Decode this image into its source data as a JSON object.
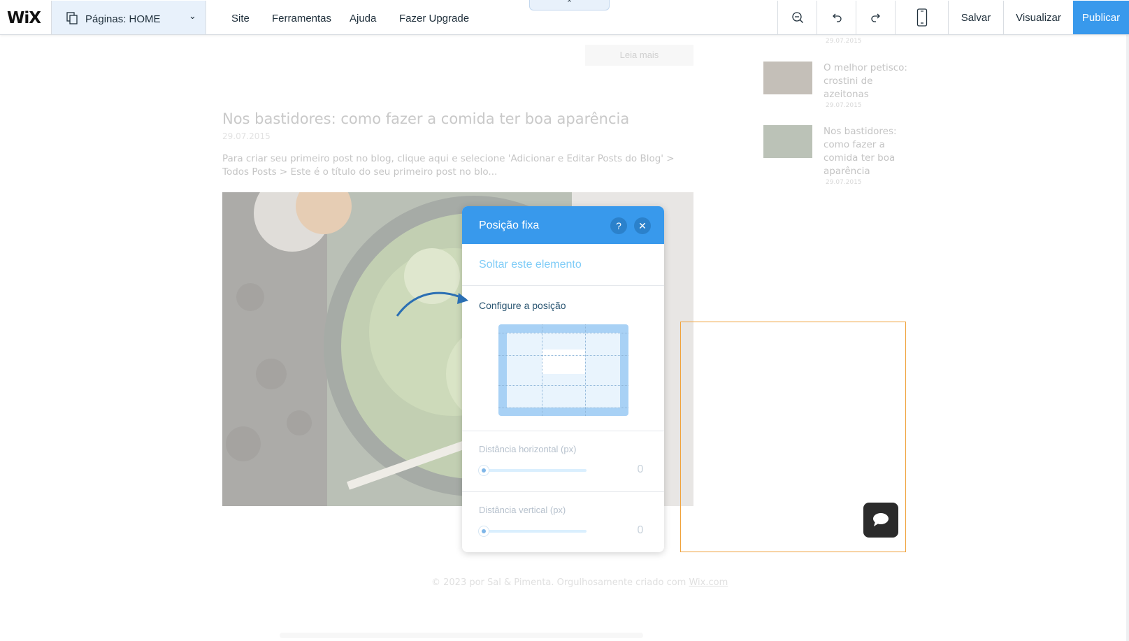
{
  "topbar": {
    "logo": "WiX",
    "pages_label": "Páginas: HOME",
    "pages_caret": "⌄",
    "menu": [
      "Site",
      "Ferramentas",
      "Ajuda",
      "Fazer Upgrade"
    ],
    "collapse_glyph": "⌃",
    "save": "Salvar",
    "preview": "Visualizar",
    "publish": "Publicar",
    "icons": [
      "zoom-out-icon",
      "undo-icon",
      "redo-icon",
      "mobile-view-icon"
    ]
  },
  "page": {
    "read_more": "Leia mais",
    "post_title": "Nos bastidores: como fazer a comida ter boa aparência",
    "post_date": "29.07.2015",
    "post_excerpt": "Para criar seu primeiro post no blog, clique aqui e selecione 'Adicionar e Editar Posts do Blog' > Todos Posts > Este é o título do seu primeiro post no blo...",
    "sidebar_posts": [
      {
        "date": "29.07.2015"
      },
      {
        "title": "O melhor petisco: crostini de azeitonas",
        "date": "29.07.2015"
      },
      {
        "title": "Nos bastidores: como fazer a comida ter boa aparência",
        "date": "29.07.2015"
      }
    ],
    "footer_text": "© 2023 por Sal & Pimenta. Orgulhosamente criado com ",
    "footer_link": "Wix.com"
  },
  "dialog": {
    "title": "Posição fixa",
    "help": "?",
    "close": "✕",
    "release_link": "Soltar este elemento",
    "config_label": "Configure a posição",
    "horizontal_label": "Distância horizontal (px)",
    "horizontal_value": "0",
    "vertical_label": "Distância vertical (px)",
    "vertical_value": "0"
  },
  "colors": {
    "accent": "#3899ec",
    "selection": "#f0a23b",
    "chat_bg": "#2b2b2b"
  }
}
